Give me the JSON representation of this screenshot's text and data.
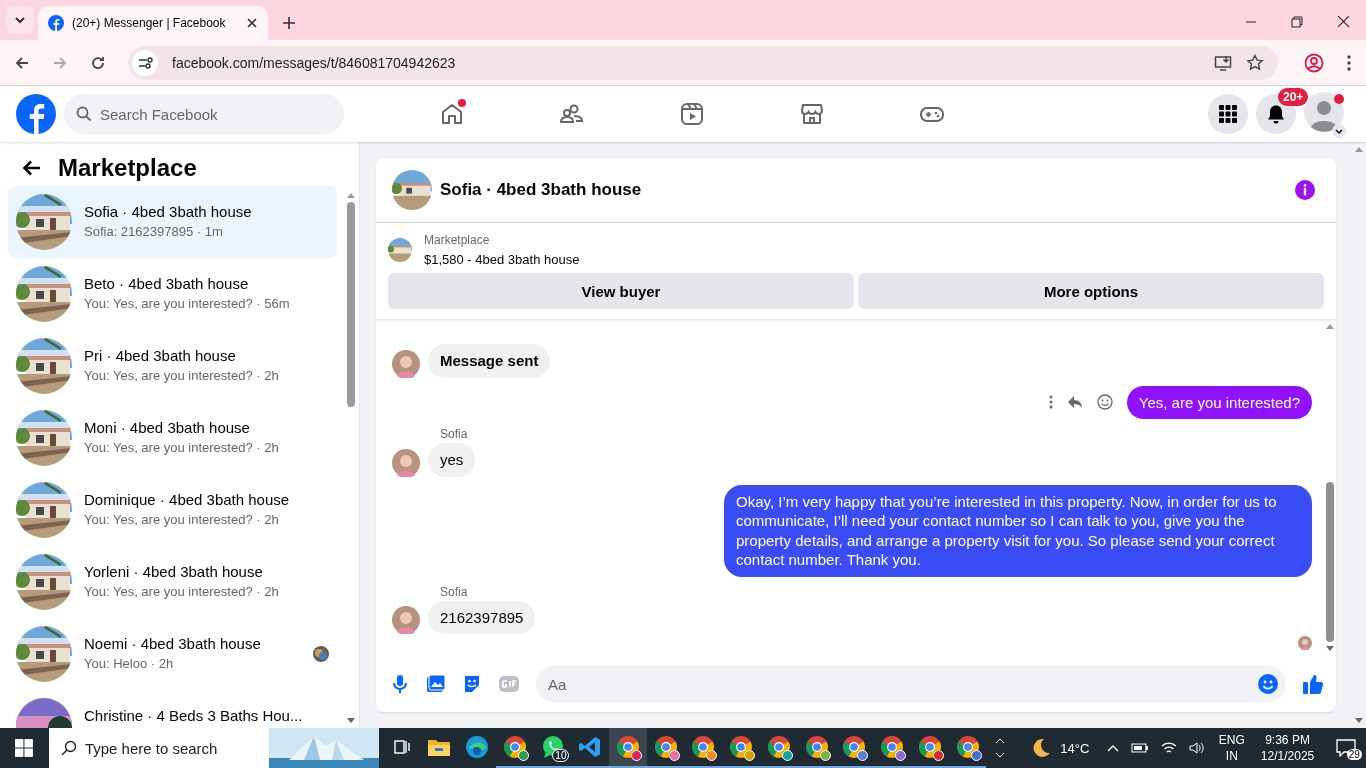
{
  "browser": {
    "tab_title": "(20+) Messenger | Facebook",
    "url": "facebook.com/messages/t/846081704942623"
  },
  "header": {
    "search_placeholder": "Search Facebook",
    "nav": [
      {
        "kind": "home",
        "dot": true
      },
      {
        "kind": "friends",
        "dot": false
      },
      {
        "kind": "video",
        "dot": false
      },
      {
        "kind": "marketplace",
        "dot": false
      },
      {
        "kind": "gaming",
        "dot": false
      }
    ],
    "notification_badge": "20+"
  },
  "sidebar": {
    "title": "Marketplace",
    "conversations": [
      {
        "name": "Sofia · 4bed 3bath house",
        "preview": "Sofia: 2162397895 · 1m",
        "selected": true,
        "seen": false,
        "kind": "house"
      },
      {
        "name": "Beto · 4bed 3bath house",
        "preview": "You: Yes, are you interested? · 56m",
        "selected": false,
        "seen": false,
        "kind": "house"
      },
      {
        "name": "Pri · 4bed 3bath house",
        "preview": "You: Yes, are you interested? · 2h",
        "selected": false,
        "seen": false,
        "kind": "house"
      },
      {
        "name": "Moni · 4bed 3bath house",
        "preview": "You: Yes, are you interested? · 2h",
        "selected": false,
        "seen": false,
        "kind": "house"
      },
      {
        "name": "Dominique · 4bed 3bath house",
        "preview": "You: Yes, are you interested? · 2h",
        "selected": false,
        "seen": false,
        "kind": "house"
      },
      {
        "name": "Yorleni · 4bed 3bath house",
        "preview": "You: Yes, are you interested? · 2h",
        "selected": false,
        "seen": false,
        "kind": "house"
      },
      {
        "name": "Noemi · 4bed 3bath house",
        "preview": "You: Heloo · 2h",
        "selected": false,
        "seen": true,
        "kind": "house"
      },
      {
        "name": "Christine · 4 Beds 3 Baths Hou...",
        "selected": false,
        "seen": false,
        "kind": "sunset"
      }
    ]
  },
  "chat": {
    "title": "Sofia · 4bed 3bath house",
    "listing": {
      "label": "Marketplace",
      "title": "$1,580 - 4bed 3bath house"
    },
    "buttons": [
      "View buyer",
      "More options"
    ],
    "messages": [
      {
        "kind": "incoming",
        "text": "Message sent",
        "bold": true,
        "avatar": true
      },
      {
        "kind": "outgoing",
        "text": "Yes, are you interested?",
        "actions": true,
        "color": "#9012fe"
      },
      {
        "kind": "incoming",
        "sender": "Sofia",
        "text": "yes",
        "bold": false,
        "avatar": true
      },
      {
        "kind": "outgoing",
        "text": "Okay, I’m very happy that you’re interested in this property. Now, in order for us to communicate, I’ll need your contact number so I can talk to you, give you the property details, and arrange a property visit for you. So please send your correct contact number. Thank you.",
        "actions": false,
        "color": "#3a4cf5"
      },
      {
        "kind": "incoming",
        "sender": "Sofia",
        "text": "2162397895",
        "bold": false,
        "avatar": true
      }
    ],
    "composer_placeholder": "Aa"
  },
  "taskbar": {
    "search_placeholder": "Type here to search",
    "apps": [
      {
        "kind": "taskview",
        "selected": false
      },
      {
        "kind": "explorer",
        "selected": false
      },
      {
        "kind": "edge",
        "selected": false
      },
      {
        "kind": "chrome",
        "selected": false,
        "color": "#2e9a4a"
      },
      {
        "kind": "whatsapp",
        "selected": false,
        "badge": "10"
      },
      {
        "kind": "vscode",
        "selected": false
      },
      {
        "kind": "chrome",
        "selected": true,
        "color": "#e0245e"
      },
      {
        "kind": "chrome",
        "selected": false,
        "color": "#e96bb0"
      },
      {
        "kind": "chrome",
        "selected": false,
        "color": "#f08a24"
      },
      {
        "kind": "chrome",
        "selected": false,
        "color": "#d8a300"
      },
      {
        "kind": "chrome",
        "selected": false,
        "color": "#17a2a2"
      },
      {
        "kind": "chrome",
        "selected": false,
        "color": "#7cb342"
      },
      {
        "kind": "chrome",
        "selected": false,
        "color": "#5b7fd6"
      },
      {
        "kind": "chrome",
        "selected": false,
        "color": "#8e6bd1"
      },
      {
        "kind": "chrome",
        "selected": false,
        "color": "#d32f2f"
      },
      {
        "kind": "chrome",
        "selected": false,
        "color": "#3f6fd8"
      }
    ],
    "weather": "14°C",
    "language": "ENG",
    "region": "IN",
    "time": "9:36 PM",
    "date": "12/1/2025",
    "notifications": "29"
  }
}
